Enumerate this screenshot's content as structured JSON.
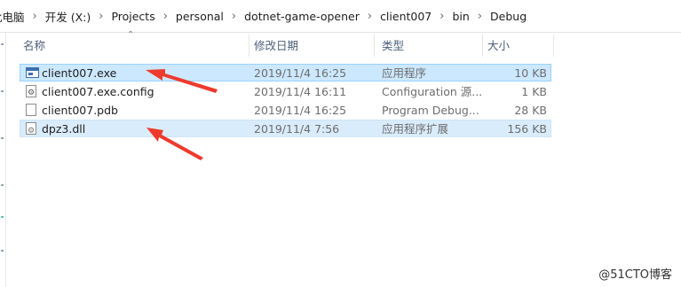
{
  "breadcrumb": [
    "此电脑",
    "开发 (X:)",
    "Projects",
    "personal",
    "dotnet-game-opener",
    "client007",
    "bin",
    "Debug"
  ],
  "columns": {
    "name": "名称",
    "modified": "修改日期",
    "type": "类型",
    "size": "大小"
  },
  "files": [
    {
      "name": "client007.exe",
      "modified": "2019/11/4 16:25",
      "type": "应用程序",
      "size": "10 KB",
      "icon": "exe-icon"
    },
    {
      "name": "client007.exe.config",
      "modified": "2019/11/4 16:11",
      "type": "Configuration 源...",
      "size": "1 KB",
      "icon": "config-file-icon"
    },
    {
      "name": "client007.pdb",
      "modified": "2019/11/4 16:25",
      "type": "Program Debug...",
      "size": "28 KB",
      "icon": "file-icon"
    },
    {
      "name": "dpz3.dll",
      "modified": "2019/11/4 7:56",
      "type": "应用程序扩展",
      "size": "156 KB",
      "icon": "dll-icon"
    }
  ],
  "annotation_color": "#ee3a2c",
  "selection_color": "#cce8ff",
  "watermark": "@51CTO博客"
}
